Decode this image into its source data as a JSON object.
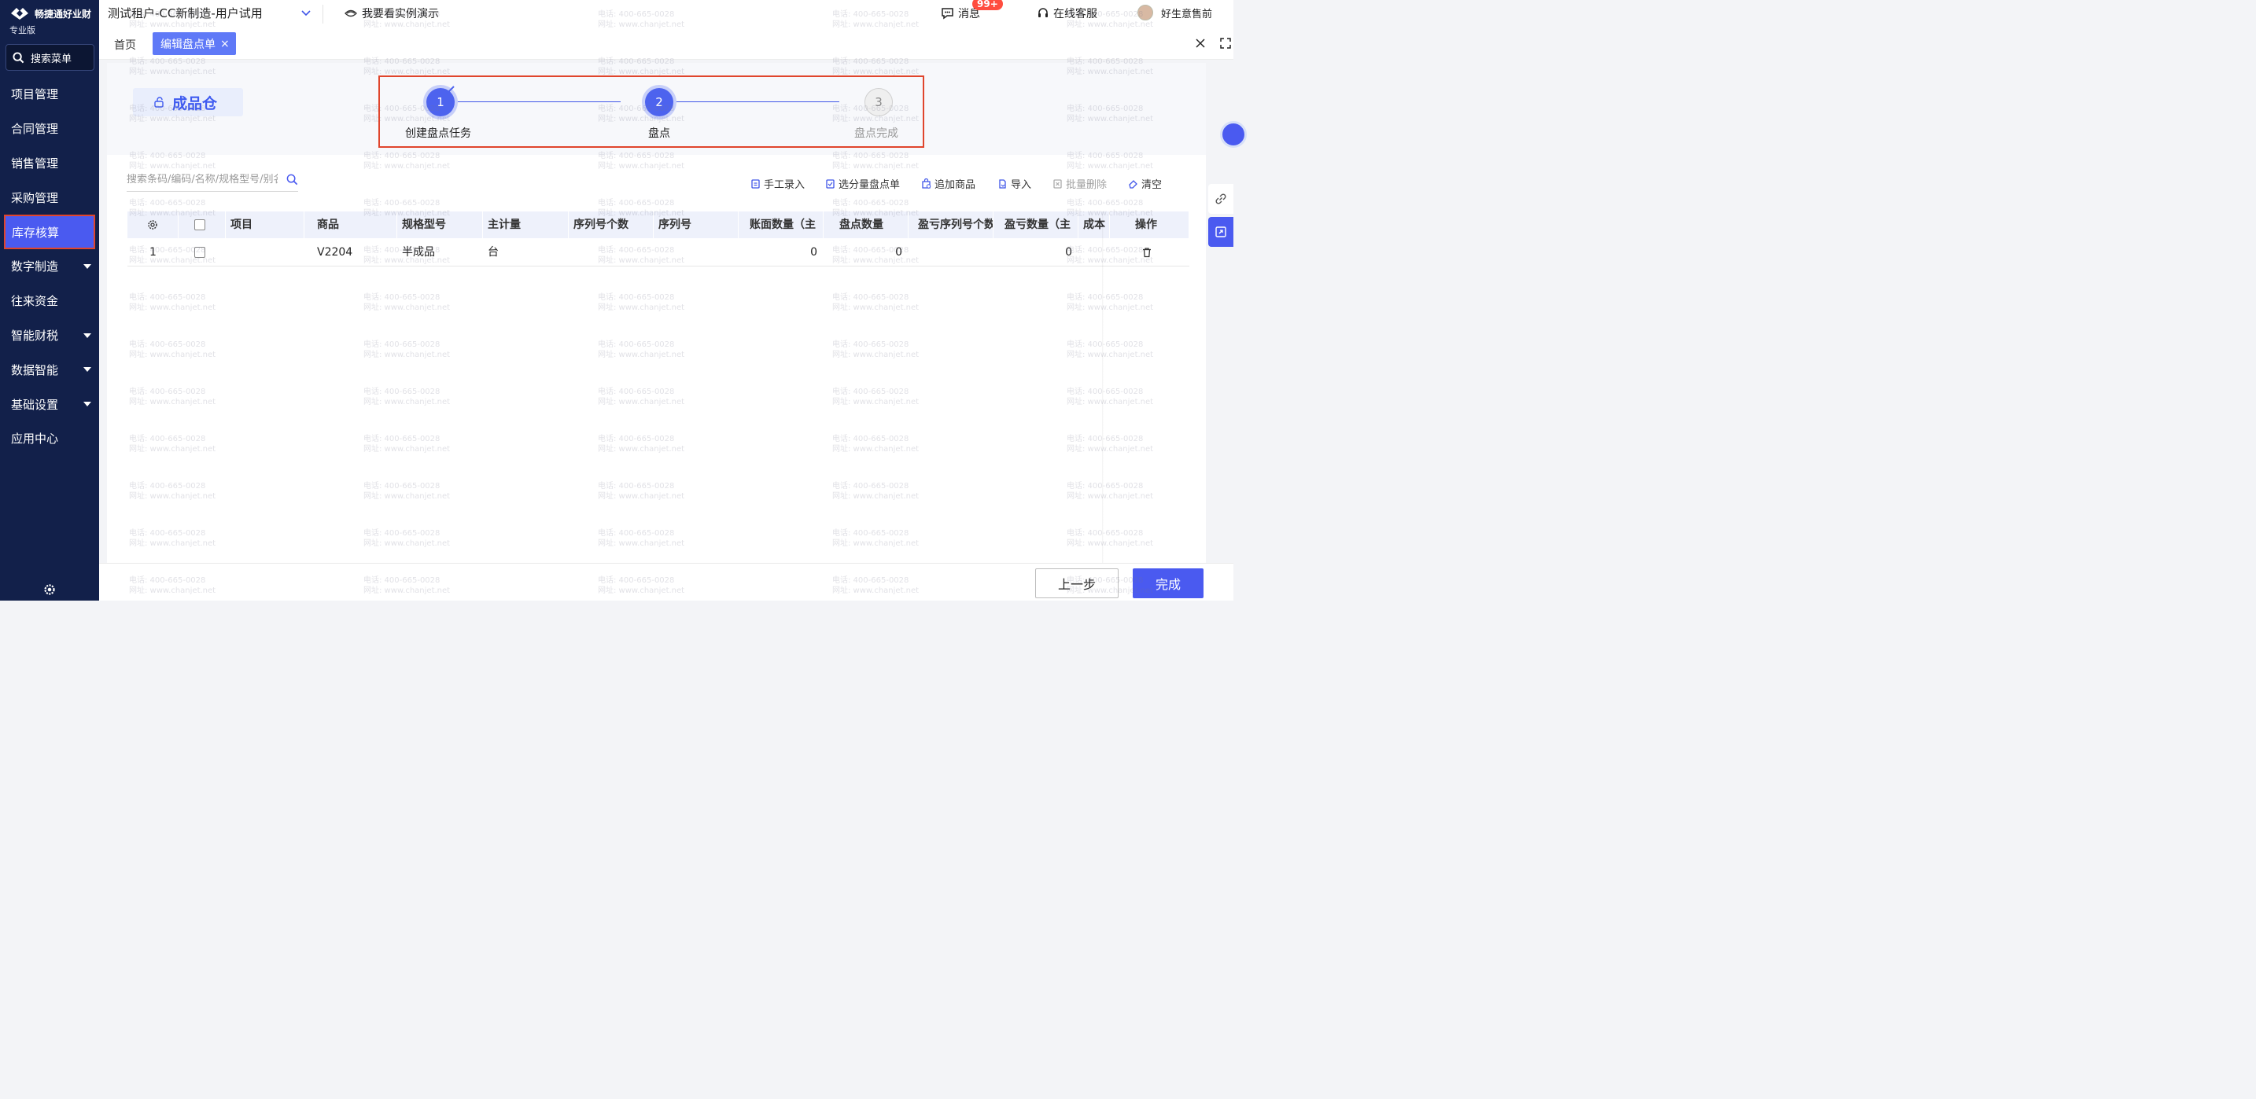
{
  "brand": {
    "name": "畅捷通好业财",
    "edition": "专业版"
  },
  "sidebar": {
    "search_label": "搜索菜单",
    "items": [
      {
        "label": "项目管理",
        "has_caret": false,
        "active": false
      },
      {
        "label": "合同管理",
        "has_caret": false,
        "active": false
      },
      {
        "label": "销售管理",
        "has_caret": false,
        "active": false
      },
      {
        "label": "采购管理",
        "has_caret": false,
        "active": false
      },
      {
        "label": "库存核算",
        "has_caret": false,
        "active": true
      },
      {
        "label": "数字制造",
        "has_caret": true,
        "active": false
      },
      {
        "label": "往来资金",
        "has_caret": false,
        "active": false
      },
      {
        "label": "智能财税",
        "has_caret": true,
        "active": false
      },
      {
        "label": "数据智能",
        "has_caret": true,
        "active": false
      },
      {
        "label": "基础设置",
        "has_caret": true,
        "active": false
      },
      {
        "label": "应用中心",
        "has_caret": false,
        "active": false
      }
    ]
  },
  "topbar": {
    "tenant": "测试租户-CC新制造-用户试用",
    "demo": "我要看实例演示",
    "messages": "消息",
    "messages_badge": "99+",
    "support": "在线客服",
    "user": "好生意售前"
  },
  "tabs": {
    "home": "首页",
    "active": "编辑盘点单",
    "close": "×"
  },
  "warehouse": {
    "name": "成品仓"
  },
  "steps": [
    {
      "number": "1",
      "label": "创建盘点任务",
      "state": "done"
    },
    {
      "number": "2",
      "label": "盘点",
      "state": "current"
    },
    {
      "number": "3",
      "label": "盘点完成",
      "state": "todo"
    }
  ],
  "search": {
    "placeholder": "搜索条码/编码/名称/规格型号/别名"
  },
  "toolbar": {
    "manual": "手工录入",
    "select_split": "选分量盘点单",
    "add_goods": "追加商品",
    "import": "导入",
    "batch_delete": "批量删除",
    "clear": "清空"
  },
  "table": {
    "headers": [
      "项目",
      "商品",
      "规格型号",
      "主计量",
      "序列号个数",
      "序列号",
      "账面数量（主",
      "盘点数量",
      "盈亏序列号个数",
      "盈亏数量（主",
      "成本",
      "操作"
    ],
    "rows": [
      {
        "index": "1",
        "project": "",
        "goods": "V2204",
        "spec": "半成品",
        "unit": "台",
        "serial_count": "",
        "serial": "",
        "book_qty": "0",
        "count_qty": "0",
        "diff_serial": "",
        "diff_qty": "0",
        "cost": ""
      }
    ]
  },
  "footer": {
    "prev": "上一步",
    "done": "完成"
  },
  "watermark": {
    "phone": "电话: 400-665-0028",
    "site": "网址: www.chanjet.net"
  },
  "colors": {
    "primary": "#4a5af0",
    "sidebar": "#12204a",
    "highlight_border": "#e0452c",
    "badge": "#ff4d3f"
  }
}
